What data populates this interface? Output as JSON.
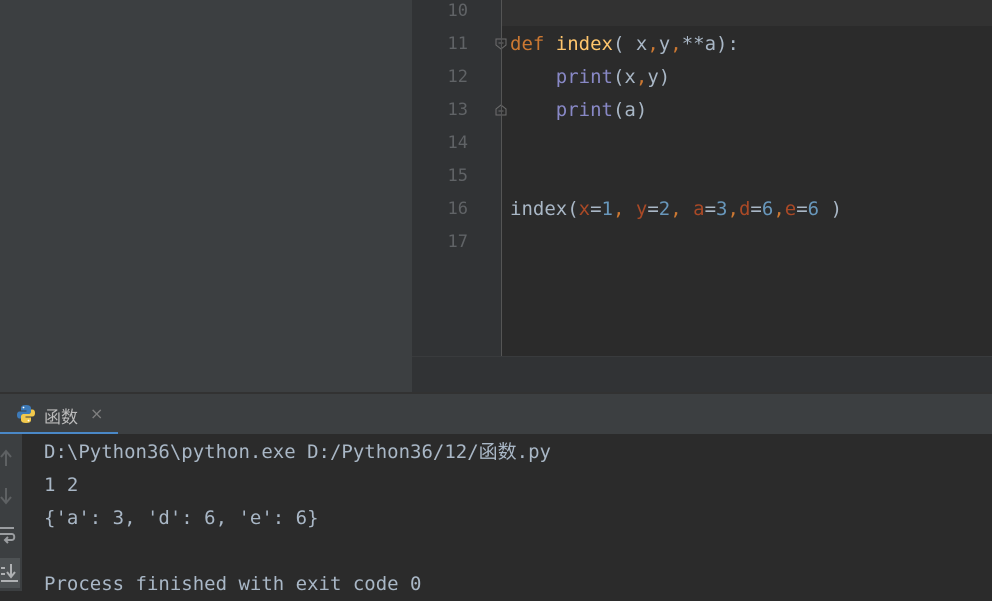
{
  "editor": {
    "lines": [
      {
        "no": "10"
      },
      {
        "no": "11"
      },
      {
        "no": "12"
      },
      {
        "no": "13"
      },
      {
        "no": "14"
      },
      {
        "no": "15"
      },
      {
        "no": "16"
      },
      {
        "no": "17"
      }
    ],
    "code": {
      "l11": [
        "def",
        " ",
        "index",
        "(",
        " x",
        ",",
        "y",
        ",",
        "**a",
        "):"
      ],
      "l12": [
        "    ",
        "print",
        "(x",
        ",",
        "y)"
      ],
      "l13": [
        "    ",
        "print",
        "(a)"
      ],
      "l16": [
        "index(",
        "x",
        "=",
        "1",
        ", ",
        "y",
        "=",
        "2",
        ", ",
        "a",
        "=",
        "3",
        ",",
        "d",
        "=",
        "6",
        ",",
        "e",
        "=",
        "6",
        " )"
      ]
    }
  },
  "run_panel": {
    "tab_label": "函数",
    "close_symbol": "×",
    "icon": "python-icon",
    "toolbar": [
      "arrow-up-icon",
      "arrow-down-icon",
      "soft-wrap-icon",
      "scroll-to-end-icon"
    ],
    "output": [
      "D:\\Python36\\python.exe D:/Python36/12/函数.py",
      "1 2",
      "{'a': 3, 'd': 6, 'e': 6}",
      "",
      "Process finished with exit code 0"
    ]
  },
  "colors": {
    "keyword": "#cc7832",
    "function": "#ffc66d",
    "builtin": "#8888c6",
    "param": "#aa4926",
    "number": "#6897bb",
    "text": "#a9b7c6",
    "accent": "#4a88c7"
  }
}
